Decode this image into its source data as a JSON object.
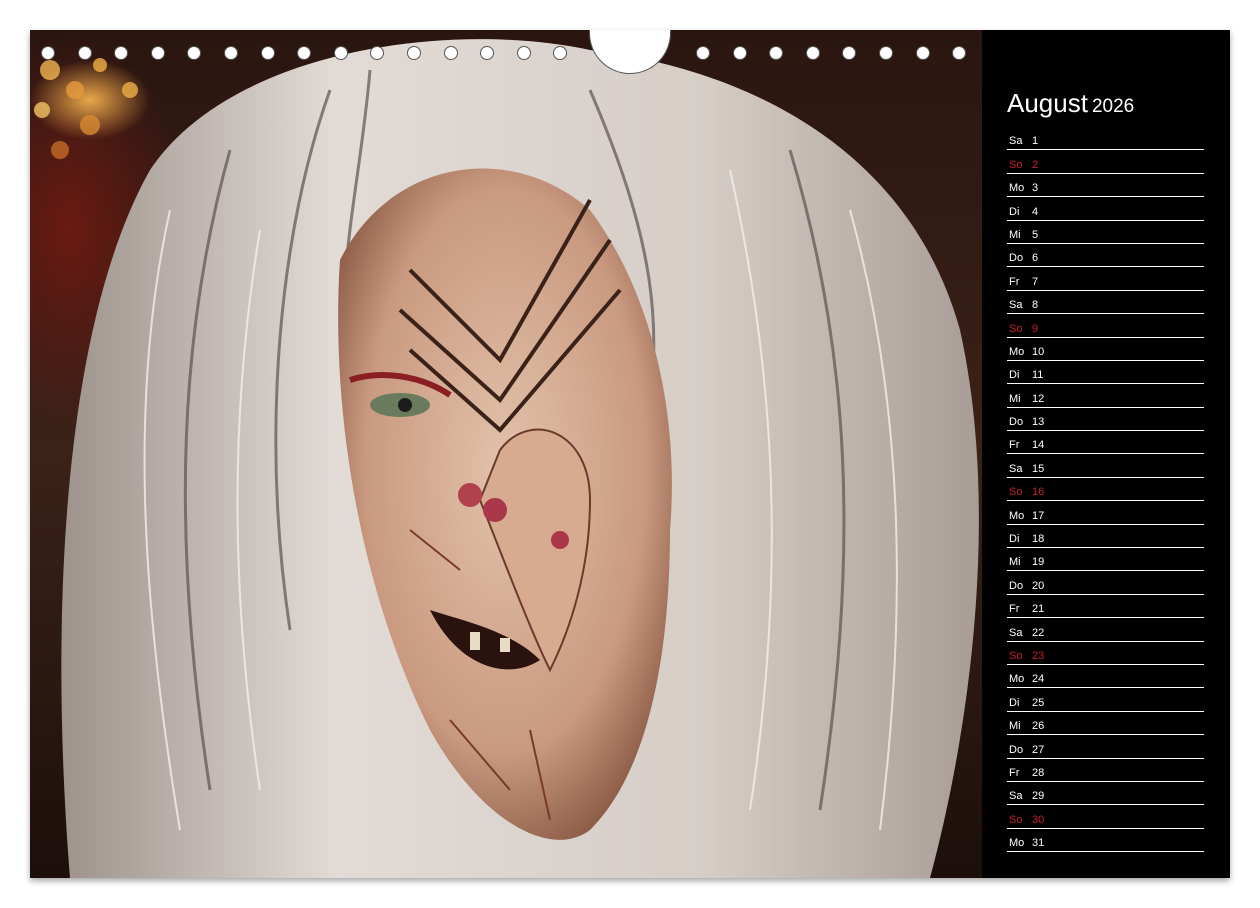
{
  "calendar": {
    "month": "August",
    "year": "2026",
    "sunday_color": "#c8202a",
    "days": [
      {
        "wd": "Sa",
        "d": "1"
      },
      {
        "wd": "So",
        "d": "2",
        "sun": true
      },
      {
        "wd": "Mo",
        "d": "3"
      },
      {
        "wd": "Di",
        "d": "4"
      },
      {
        "wd": "Mi",
        "d": "5"
      },
      {
        "wd": "Do",
        "d": "6"
      },
      {
        "wd": "Fr",
        "d": "7"
      },
      {
        "wd": "Sa",
        "d": "8"
      },
      {
        "wd": "So",
        "d": "9",
        "sun": true
      },
      {
        "wd": "Mo",
        "d": "10"
      },
      {
        "wd": "Di",
        "d": "11"
      },
      {
        "wd": "Mi",
        "d": "12"
      },
      {
        "wd": "Do",
        "d": "13"
      },
      {
        "wd": "Fr",
        "d": "14"
      },
      {
        "wd": "Sa",
        "d": "15"
      },
      {
        "wd": "So",
        "d": "16",
        "sun": true
      },
      {
        "wd": "Mo",
        "d": "17"
      },
      {
        "wd": "Di",
        "d": "18"
      },
      {
        "wd": "Mi",
        "d": "19"
      },
      {
        "wd": "Do",
        "d": "20"
      },
      {
        "wd": "Fr",
        "d": "21"
      },
      {
        "wd": "Sa",
        "d": "22"
      },
      {
        "wd": "So",
        "d": "23",
        "sun": true
      },
      {
        "wd": "Mo",
        "d": "24"
      },
      {
        "wd": "Di",
        "d": "25"
      },
      {
        "wd": "Mi",
        "d": "26"
      },
      {
        "wd": "Do",
        "d": "27"
      },
      {
        "wd": "Fr",
        "d": "28"
      },
      {
        "wd": "Sa",
        "d": "29"
      },
      {
        "wd": "So",
        "d": "30",
        "sun": true
      },
      {
        "wd": "Mo",
        "d": "31"
      }
    ]
  }
}
